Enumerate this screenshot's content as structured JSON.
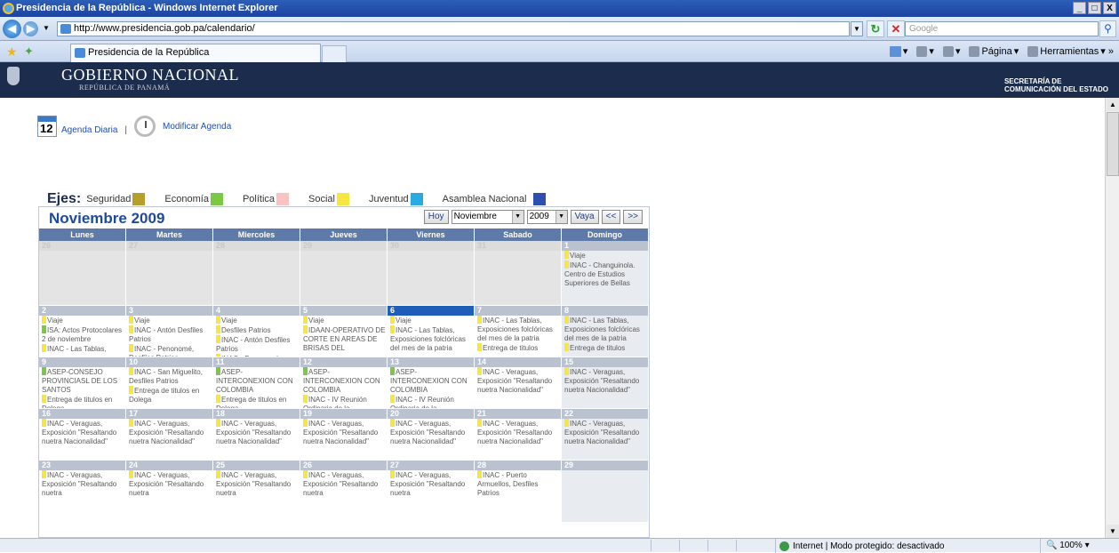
{
  "browser": {
    "window_title": "Presidencia de la República - Windows Internet Explorer",
    "window_buttons": [
      "_",
      "□",
      "X"
    ],
    "url": "http://www.presidencia.gob.pa/calendario/",
    "search_placeholder": "Google",
    "tab_title": "Presidencia de la República",
    "cmd_pagina": "Página",
    "cmd_herramientas": "Herramientas",
    "status_zone": "Internet | Modo protegido: desactivado",
    "zoom": "100%"
  },
  "header": {
    "title": "GOBIERNO NACIONAL",
    "subtitle": "REPÚBLICA DE PANAMÁ",
    "secretaria_line1": "SECRETARÍA DE",
    "secretaria_line2": "COMUNICACIÓN DEL ESTADO"
  },
  "agenda": {
    "cal_icon_number": "12",
    "daily_label": "Agenda Diaria",
    "separator": "|",
    "modify_label": "Modificar Agenda"
  },
  "ejes": {
    "label": "Ejes:",
    "items": [
      {
        "name": "Seguridad",
        "color": "#b4a02a"
      },
      {
        "name": "Economía",
        "color": "#7ac943"
      },
      {
        "name": "Política",
        "color": "#f7c3c3"
      },
      {
        "name": "Social",
        "color": "#f7e640"
      },
      {
        "name": "Juventud",
        "color": "#29abe2"
      },
      {
        "name": "Asamblea Nacional",
        "color": "#2f4fb0"
      }
    ]
  },
  "calendar": {
    "title": "Noviembre 2009",
    "today_button": "Hoy",
    "month_select": "Noviembre",
    "year_select": "2009",
    "go_button": "Vaya",
    "prev_button": "<<",
    "next_button": ">>",
    "day_headers": [
      "Lunes",
      "Martes",
      "Miercoles",
      "Jueves",
      "Viernes",
      "Sabado",
      "Domingo"
    ],
    "weeks": [
      [
        {
          "day": "26",
          "other": true,
          "events": []
        },
        {
          "day": "27",
          "other": true,
          "events": []
        },
        {
          "day": "28",
          "other": true,
          "events": []
        },
        {
          "day": "29",
          "other": true,
          "events": []
        },
        {
          "day": "30",
          "other": true,
          "events": []
        },
        {
          "day": "31",
          "other": true,
          "events": []
        },
        {
          "day": "1",
          "events": [
            {
              "color": "#f7e640",
              "text": "Viaje"
            },
            {
              "color": "#f7e640",
              "text": "INAC - Changuinola. Centro de Estudios Superiores de Bellas"
            }
          ]
        }
      ],
      [
        {
          "day": "2",
          "events": [
            {
              "color": "#f7e640",
              "text": "Viaje"
            },
            {
              "color": "#7ac943",
              "text": "ISA: Actos Protocolares 2 de noviembre"
            },
            {
              "color": "#f7e640",
              "text": "INAC - Las Tablas,"
            }
          ]
        },
        {
          "day": "3",
          "events": [
            {
              "color": "#f7e640",
              "text": "Viaje"
            },
            {
              "color": "#f7e640",
              "text": "INAC - Antón Desfiles Patrios"
            },
            {
              "color": "#f7e640",
              "text": "INAC - Penonomé, Desfiles Patrios"
            }
          ]
        },
        {
          "day": "4",
          "events": [
            {
              "color": "#f7e640",
              "text": "Viaje"
            },
            {
              "color": "#f7e640",
              "text": "Desfiles Patrios"
            },
            {
              "color": "#f7e640",
              "text": "INAC - Antón Desfiles Patrios"
            },
            {
              "color": "#f7e640",
              "text": "INAC - Penonomé,"
            }
          ]
        },
        {
          "day": "5",
          "events": [
            {
              "color": "#f7e640",
              "text": "Viaje"
            },
            {
              "color": "#f7e640",
              "text": "IDAAN-OPERATIVO DE CORTE EN AREAS DE BRISAS DEL"
            }
          ]
        },
        {
          "day": "6",
          "today": true,
          "events": [
            {
              "color": "#f7e640",
              "text": "Viaje"
            },
            {
              "color": "#f7e640",
              "text": "INAC - Las Tablas, Exposiciones folclóricas del mes de la patria"
            }
          ]
        },
        {
          "day": "7",
          "events": [
            {
              "color": "#f7e640",
              "text": "INAC - Las Tablas, Exposiciones folclóricas del mes de la patria"
            },
            {
              "color": "#f7e640",
              "text": "Entrega de titulos"
            }
          ]
        },
        {
          "day": "8",
          "events": [
            {
              "color": "#f7e640",
              "text": "INAC - Las Tablas, Exposiciones folclóricas del mes de la patria"
            },
            {
              "color": "#f7e640",
              "text": "Entrega de titulos"
            }
          ]
        }
      ],
      [
        {
          "day": "9",
          "events": [
            {
              "color": "#7ac943",
              "text": "ASEP-CONSEJO PROVINCIASL DE LOS SANTOS"
            },
            {
              "color": "#f7e640",
              "text": "Entrega de titulos en Dolega"
            }
          ]
        },
        {
          "day": "10",
          "events": [
            {
              "color": "#f7e640",
              "text": "INAC - San Miguelito, Desfiles Patrios"
            },
            {
              "color": "#f7e640",
              "text": "Entrega de titulos en Dolega"
            }
          ]
        },
        {
          "day": "11",
          "events": [
            {
              "color": "#7ac943",
              "text": "ASEP-INTERCONEXION CON COLOMBIA"
            },
            {
              "color": "#f7e640",
              "text": "Entrega de titulos en Dolega"
            }
          ]
        },
        {
          "day": "12",
          "events": [
            {
              "color": "#7ac943",
              "text": "ASEP-INTERCONEXION CON COLOMBIA"
            },
            {
              "color": "#f7e640",
              "text": "INAC - IV Reunión Ordinaria de la"
            }
          ]
        },
        {
          "day": "13",
          "events": [
            {
              "color": "#7ac943",
              "text": "ASEP-INTERCONEXION CON COLOMBIA"
            },
            {
              "color": "#f7e640",
              "text": "INAC - IV Reunión Ordinaria de la"
            }
          ]
        },
        {
          "day": "14",
          "events": [
            {
              "color": "#f7e640",
              "text": "INAC - Veraguas, Exposición \"Resaltando nuetra Nacionalidad\""
            }
          ]
        },
        {
          "day": "15",
          "events": [
            {
              "color": "#f7e640",
              "text": "INAC - Veraguas, Exposición \"Resaltando nuetra Nacionalidad\""
            }
          ]
        }
      ],
      [
        {
          "day": "16",
          "events": [
            {
              "color": "#f7e640",
              "text": "INAC - Veraguas, Exposición \"Resaltando nuetra Nacionalidad\""
            }
          ]
        },
        {
          "day": "17",
          "events": [
            {
              "color": "#f7e640",
              "text": "INAC - Veraguas, Exposición \"Resaltando nuetra Nacionalidad\""
            }
          ]
        },
        {
          "day": "18",
          "events": [
            {
              "color": "#f7e640",
              "text": "INAC - Veraguas, Exposición \"Resaltando nuetra Nacionalidad\""
            }
          ]
        },
        {
          "day": "19",
          "events": [
            {
              "color": "#f7e640",
              "text": "INAC - Veraguas, Exposición \"Resaltando nuetra Nacionalidad\""
            }
          ]
        },
        {
          "day": "20",
          "events": [
            {
              "color": "#f7e640",
              "text": "INAC - Veraguas, Exposición \"Resaltando nuetra Nacionalidad\""
            }
          ]
        },
        {
          "day": "21",
          "events": [
            {
              "color": "#f7e640",
              "text": "INAC - Veraguas, Exposición \"Resaltando nuetra Nacionalidad\""
            }
          ]
        },
        {
          "day": "22",
          "events": [
            {
              "color": "#f7e640",
              "text": "INAC - Veraguas, Exposición \"Resaltando nuetra Nacionalidad\""
            }
          ]
        }
      ],
      [
        {
          "day": "23",
          "events": [
            {
              "color": "#f7e640",
              "text": "INAC - Veraguas, Exposición \"Resaltando nuetra"
            }
          ]
        },
        {
          "day": "24",
          "events": [
            {
              "color": "#f7e640",
              "text": "INAC - Veraguas, Exposición \"Resaltando nuetra"
            }
          ]
        },
        {
          "day": "25",
          "events": [
            {
              "color": "#f7e640",
              "text": "INAC - Veraguas, Exposición \"Resaltando nuetra"
            }
          ]
        },
        {
          "day": "26",
          "events": [
            {
              "color": "#f7e640",
              "text": "INAC - Veraguas, Exposición \"Resaltando nuetra"
            }
          ]
        },
        {
          "day": "27",
          "events": [
            {
              "color": "#f7e640",
              "text": "INAC - Veraguas, Exposición \"Resaltando nuetra"
            }
          ]
        },
        {
          "day": "28",
          "events": [
            {
              "color": "#f7e640",
              "text": "INAC - Puerto Armuellos, Desfiles Patrios"
            }
          ]
        },
        {
          "day": "29",
          "events": []
        }
      ]
    ]
  }
}
